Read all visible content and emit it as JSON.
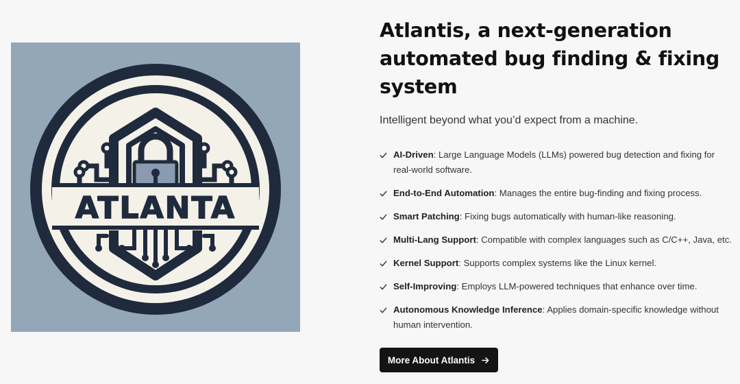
{
  "logo": {
    "wordmark": "ATLANTA",
    "colors": {
      "panel_bg": "#94a7b9",
      "navy": "#1f2a3d",
      "cream": "#f4f1e8",
      "steel": "#8a9ab0"
    }
  },
  "hero": {
    "title": "Atlantis, a next-generation automated bug finding & fixing system",
    "tagline": "Intelligent beyond what you’d expect from a machine."
  },
  "features": [
    {
      "title": "AI-Driven",
      "text": ": Large Language Models (LLMs) powered bug detection and fixing for real-world software."
    },
    {
      "title": "End-to-End Automation",
      "text": ": Manages the entire bug-finding and fixing process."
    },
    {
      "title": "Smart Patching",
      "text": ": Fixing bugs automatically with human-like reasoning."
    },
    {
      "title": "Multi-Lang Support",
      "text": ": Compatible with complex languages such as C/C++, Java, etc."
    },
    {
      "title": "Kernel Support",
      "text": ": Supports complex systems like the Linux kernel."
    },
    {
      "title": "Self-Improving",
      "text": ": Employs LLM-powered techniques that enhance over time."
    },
    {
      "title": "Autonomous Knowledge Inference",
      "text": ": Applies domain-specific knowledge without human intervention."
    }
  ],
  "cta": {
    "label": "More About Atlantis",
    "icon": "arrow-right-icon"
  },
  "icons": {
    "feature_marker": "check-icon"
  }
}
